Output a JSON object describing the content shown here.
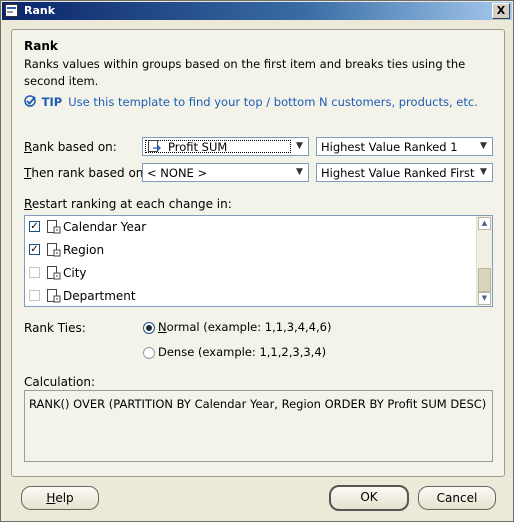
{
  "window": {
    "title": "Rank",
    "close_label": "X"
  },
  "panel": {
    "heading": "Rank",
    "description": "Ranks values within groups based on the first item and breaks ties using the second item.",
    "tip_label": "TIP",
    "tip_text": "Use this template to find your top / bottom N customers, products, etc."
  },
  "rank_based_on": {
    "label_key": "R",
    "label_rest": "ank based on:",
    "item_value": "Profit SUM",
    "order_value": "Highest Value Ranked 1"
  },
  "then_rank_based_on": {
    "label_key": "T",
    "label_rest": "hen rank based on:",
    "item_value": "< NONE >",
    "order_value": "Highest Value Ranked First"
  },
  "restart": {
    "label_key": "R",
    "label_rest": "estart ranking at each change in:",
    "items": [
      {
        "label": "Calendar Year",
        "checked": true
      },
      {
        "label": "Region",
        "checked": true
      },
      {
        "label": "City",
        "checked": false
      },
      {
        "label": "Department",
        "checked": false
      }
    ]
  },
  "rank_ties": {
    "label": "Rank Ties:",
    "normal_key": "N",
    "normal_rest": "ormal (example: 1,1,3,4,4,6)",
    "dense_label": "Dense (example: 1,1,2,3,3,4)",
    "selected": "normal"
  },
  "calculation": {
    "label": "Calculation:",
    "text": "RANK() OVER (PARTITION BY Calendar Year, Region ORDER BY Profit SUM DESC)"
  },
  "buttons": {
    "help_key": "H",
    "help_rest": "elp",
    "ok": "OK",
    "cancel": "Cancel"
  },
  "colors": {
    "accent": "#1c5cb4",
    "titlebar": "#0a246a",
    "panel_bg": "#f4f3ea"
  }
}
